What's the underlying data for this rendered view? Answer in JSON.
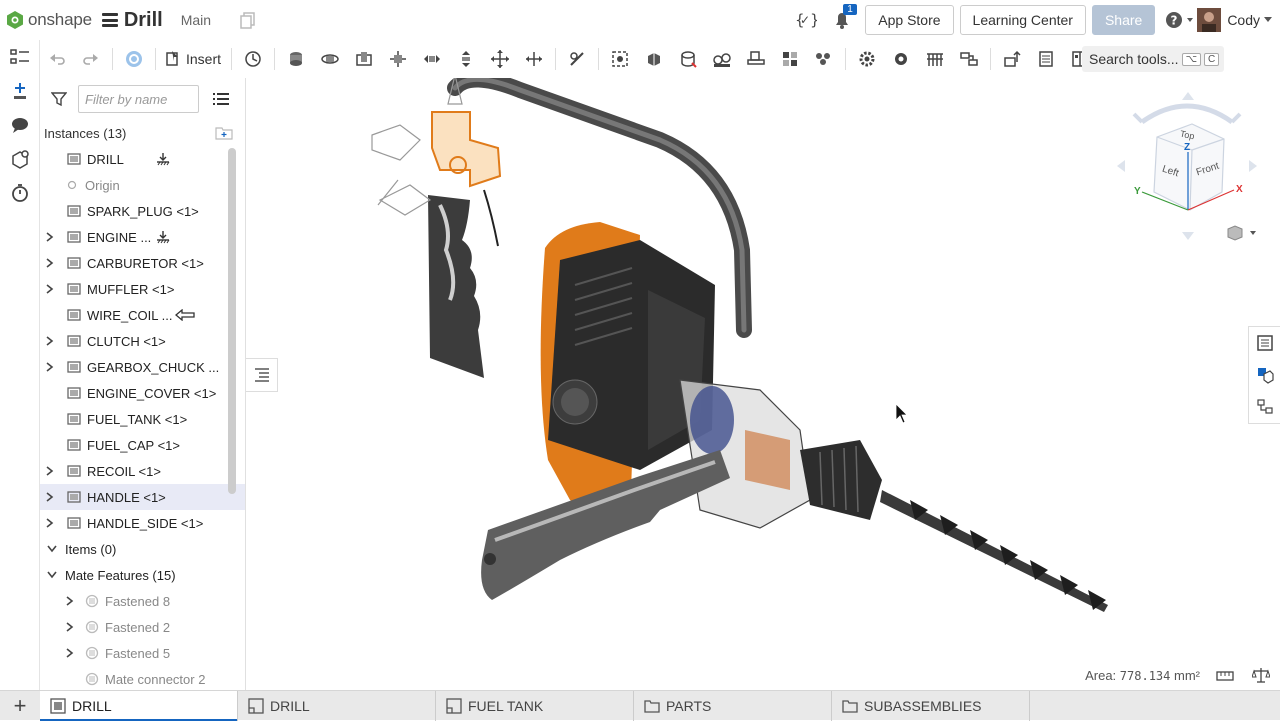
{
  "app": {
    "logo_text": "onshape",
    "document_title": "Drill",
    "workspace": "Main",
    "notification_count": "1"
  },
  "header": {
    "app_store": "App Store",
    "learning_center": "Learning Center",
    "share": "Share",
    "user_name": "Cody"
  },
  "toolbar": {
    "insert_label": "Insert",
    "search_tools": "Search tools...",
    "shortcut_1": "⌥",
    "shortcut_2": "C"
  },
  "filter": {
    "placeholder": "Filter by name"
  },
  "instances": {
    "header": "Instances (13)",
    "items": [
      {
        "label": "DRILL",
        "expandable": false
      },
      {
        "label": "Origin",
        "expandable": false
      },
      {
        "label": "SPARK_PLUG <1>",
        "expandable": false
      },
      {
        "label": "ENGINE ...",
        "expandable": true
      },
      {
        "label": "CARBURETOR <1>",
        "expandable": true
      },
      {
        "label": "MUFFLER <1>",
        "expandable": true
      },
      {
        "label": "WIRE_COIL ...",
        "expandable": false
      },
      {
        "label": "CLUTCH <1>",
        "expandable": true
      },
      {
        "label": "GEARBOX_CHUCK ...",
        "expandable": true
      },
      {
        "label": "ENGINE_COVER <1>",
        "expandable": false
      },
      {
        "label": "FUEL_TANK <1>",
        "expandable": false
      },
      {
        "label": "FUEL_CAP <1>",
        "expandable": false
      },
      {
        "label": "RECOIL <1>",
        "expandable": true
      },
      {
        "label": "HANDLE <1>",
        "expandable": true,
        "selected": true
      },
      {
        "label": "HANDLE_SIDE <1>",
        "expandable": true
      }
    ]
  },
  "items_section": {
    "label": "Items (0)"
  },
  "mate_features": {
    "label": "Mate Features (15)",
    "items": [
      "Fastened 8",
      "Fastened 2",
      "Fastened 5",
      "Mate connector 2"
    ]
  },
  "viewcube": {
    "top": "Top",
    "left": "Left",
    "front": "Front",
    "axis_x": "X",
    "axis_y": "Y",
    "axis_z": "Z"
  },
  "status": {
    "area_label": "Area:",
    "area_value": "778.134",
    "area_unit": "mm²"
  },
  "tabs": [
    {
      "label": "DRILL",
      "kind": "assembly",
      "active": true
    },
    {
      "label": "DRILL",
      "kind": "partstudio",
      "active": false
    },
    {
      "label": "FUEL TANK",
      "kind": "partstudio",
      "active": false
    },
    {
      "label": "PARTS",
      "kind": "folder",
      "active": false
    },
    {
      "label": "SUBASSEMBLIES",
      "kind": "folder",
      "active": false
    }
  ],
  "colors": {
    "accent": "#1565c0",
    "brand_green": "#5aa845",
    "part_orange": "#e07b1a",
    "body_dark": "#2b2b2b",
    "handle_grey": "#6b6b6b",
    "selection_blue": "#e8eaf6"
  }
}
